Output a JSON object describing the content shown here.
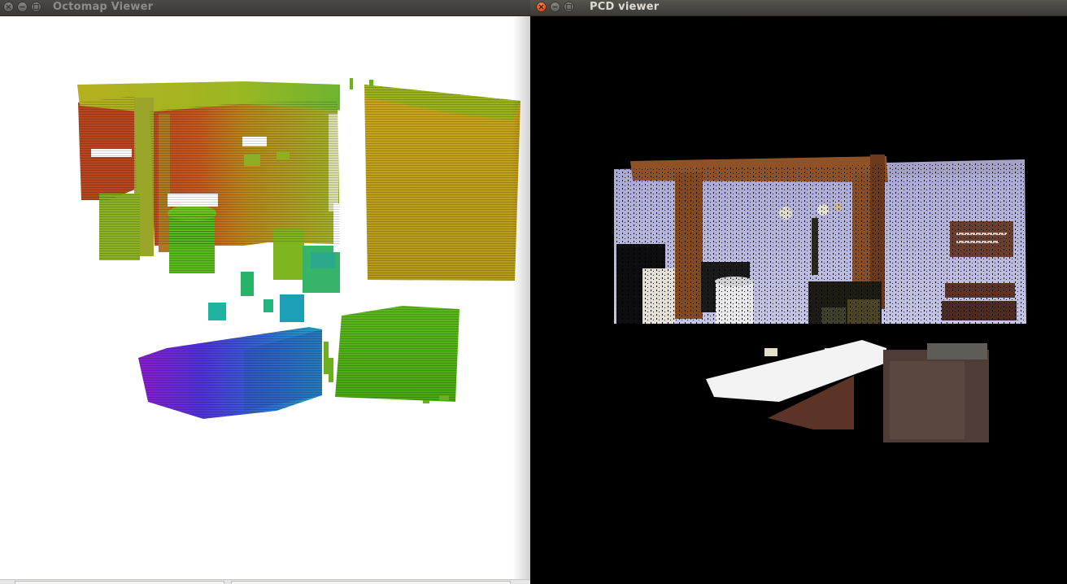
{
  "windows": {
    "octomap": {
      "title": "Octomap Viewer",
      "controls": [
        "close-icon",
        "minimize-icon",
        "maximize-icon"
      ],
      "background_color": "#ffffff",
      "color_scheme": "height-coded rainbow (purple, blue, cyan, green, yellow, orange, red)"
    },
    "pcd": {
      "title": "PCD viewer",
      "controls": [
        "close-icon",
        "minimize-icon",
        "maximize-icon"
      ],
      "background_color": "#000000",
      "colors": {
        "wall": "#b8b8df",
        "beam": "#8a4e24",
        "desk": "#5b3427"
      }
    }
  }
}
